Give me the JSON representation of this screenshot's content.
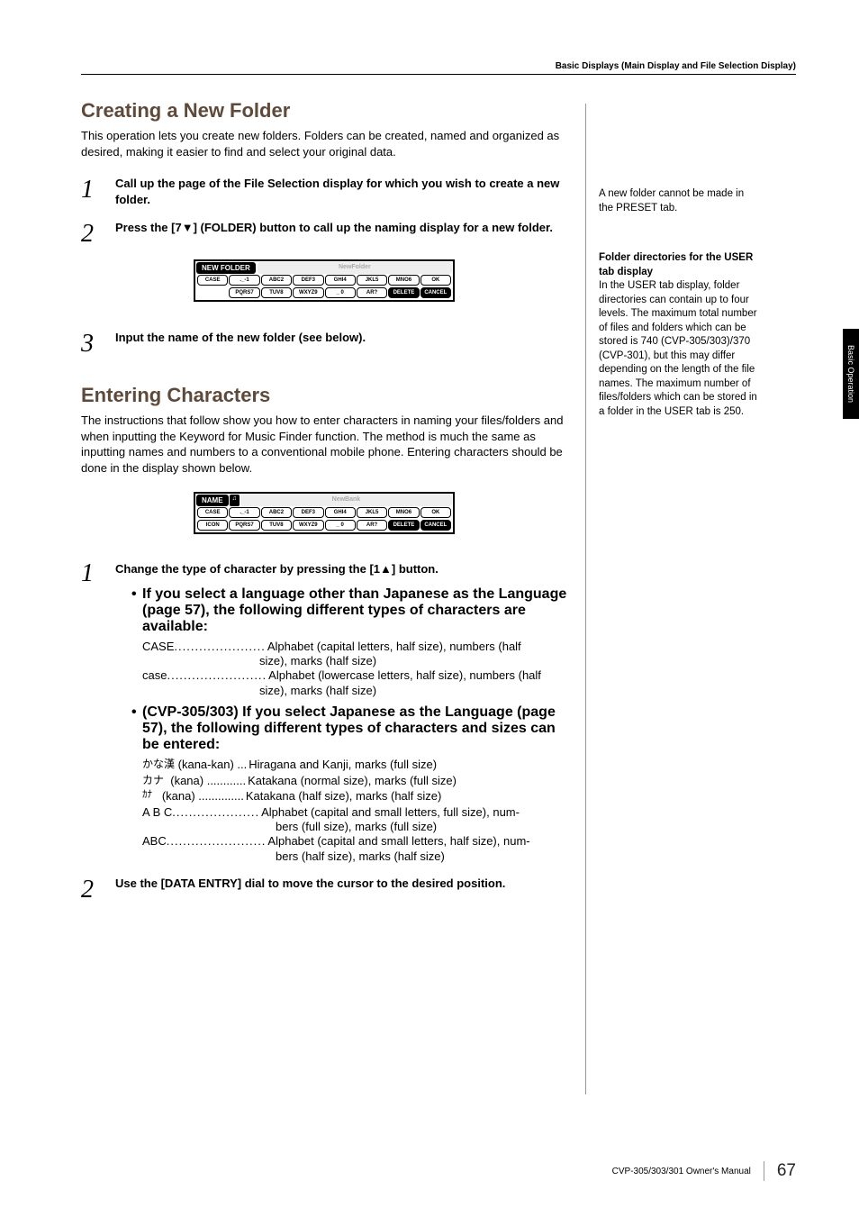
{
  "header": "Basic Displays (Main Display and File Selection Display)",
  "section1": {
    "title": "Creating a New Folder",
    "intro": "This operation lets you create new folders. Folders can be created, named and organized as desired, making it easier to find and select your original data.",
    "steps": {
      "s1": "Call up the page of the File Selection display for which you wish to create a new folder.",
      "s2": "Press the [7▼] (FOLDER) button to call up the naming display for a new folder.",
      "s3": "Input the name of the new folder (see below)."
    }
  },
  "display1": {
    "tab": "NEW FOLDER",
    "field": "NewFolder",
    "row1": [
      "CASE",
      "._-1",
      "ABC2",
      "DEF3",
      "GHI4",
      "JKL5",
      "MNO6",
      "OK"
    ],
    "row2": [
      "",
      "PQRS7",
      "TUV8",
      "WXYZ9",
      "_ 0",
      "AR?",
      "DELETE",
      "CANCEL"
    ]
  },
  "section2": {
    "title": "Entering Characters",
    "intro": "The instructions that follow show you how to enter characters in naming your files/folders and when inputting the Keyword for Music Finder function. The method is much the same as inputting names and numbers to a conventional mobile phone. Entering characters should be done in the display shown below."
  },
  "display2": {
    "tab": "NAME",
    "field": "NewBank",
    "row1": [
      "CASE",
      "._-1",
      "ABC2",
      "DEF3",
      "GHI4",
      "JKL5",
      "MNO6",
      "OK"
    ],
    "row2": [
      "ICON",
      "PQRS7",
      "TUV8",
      "WXYZ9",
      "_ 0",
      "AR?",
      "DELETE",
      "CANCEL"
    ]
  },
  "entering": {
    "step1": "Change the type of character by pressing the [1▲] button.",
    "bullet1": "If you select a language other than Japanese as the Language (page 57), the following different types of characters are available:",
    "defs1": {
      "CASE": "Alphabet (capital letters, half size), numbers (half size), marks (half size)",
      "case": "Alphabet (lowercase letters, half size), numbers (half size), marks (half size)"
    },
    "bullet2": "(CVP-305/303) If you select Japanese as the Language (page 57), the following different types of characters and sizes can be entered:",
    "jp_kanakan": "かな漢",
    "jp_kanakan_lbl": "(kana-kan) ...",
    "jp_kanakan_dd": "Hiragana and Kanji, marks (full size)",
    "jp_kana": "カナ",
    "jp_kana_lbl": "(kana) ............",
    "jp_kana_dd": "Katakana (normal size), marks (full size)",
    "jp_kanah": "ｶﾅ",
    "jp_kanah_lbl": "(kana) ..............",
    "jp_kanah_dd": "Katakana (half size), marks (half size)",
    "abc_sp": "A B C",
    "abc_sp_dots": ".....................",
    "abc_sp_dd": "Alphabet (capital and small letters, full size), numbers (full size), marks (full size)",
    "abc": "ABC",
    "abc_dots": "........................",
    "abc_dd": "Alphabet (capital and small letters, half size), numbers (half size), marks (half size)",
    "step2": "Use the [DATA ENTRY] dial to move the cursor to the desired position."
  },
  "sidebar": {
    "note1": "A new folder cannot be made in the PRESET tab.",
    "title2": "Folder directories for the USER tab display",
    "note2": "In the USER tab display, folder directories can contain up to four levels. The maximum total number of files and folders which can be stored is 740 (CVP-305/303)/370 (CVP-301), but this may differ depending on the length of the file names. The maximum number of files/folders which can be stored in a folder in the USER tab is 250."
  },
  "side_tab": "Basic Operation",
  "footer": {
    "text": "CVP-305/303/301 Owner's Manual",
    "page": "67"
  }
}
